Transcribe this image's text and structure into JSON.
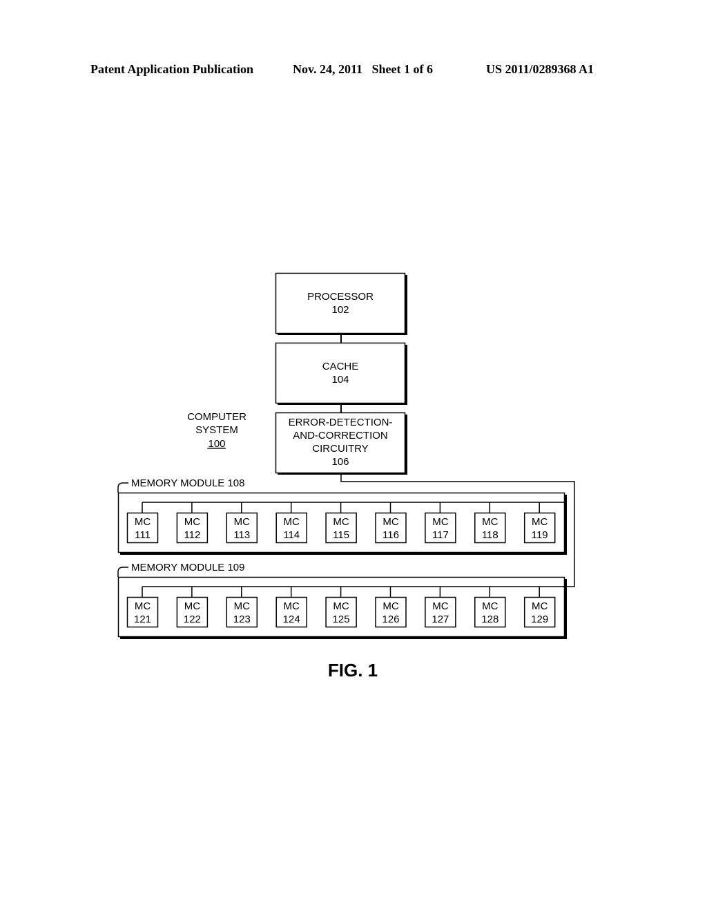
{
  "header": {
    "publication": "Patent Application Publication",
    "date_sheet": "Nov. 24, 2011   Sheet 1 of 6",
    "patent_number": "US 2011/0289368 A1"
  },
  "diagram": {
    "system_label": [
      "COMPUTER",
      "SYSTEM"
    ],
    "system_number": "100",
    "processor": [
      "PROCESSOR",
      "102"
    ],
    "cache": [
      "CACHE",
      "104"
    ],
    "ecc": [
      "ERROR-DETECTION-",
      "AND-CORRECTION",
      "CIRCUITRY",
      "106"
    ],
    "modules": [
      {
        "label": "MEMORY MODULE 108",
        "chips": [
          "111",
          "112",
          "113",
          "114",
          "115",
          "116",
          "117",
          "118",
          "119"
        ]
      },
      {
        "label": "MEMORY MODULE 109",
        "chips": [
          "121",
          "122",
          "123",
          "124",
          "125",
          "126",
          "127",
          "128",
          "129"
        ]
      }
    ],
    "chip_prefix": "MC",
    "figure_label": "FIG. 1"
  }
}
